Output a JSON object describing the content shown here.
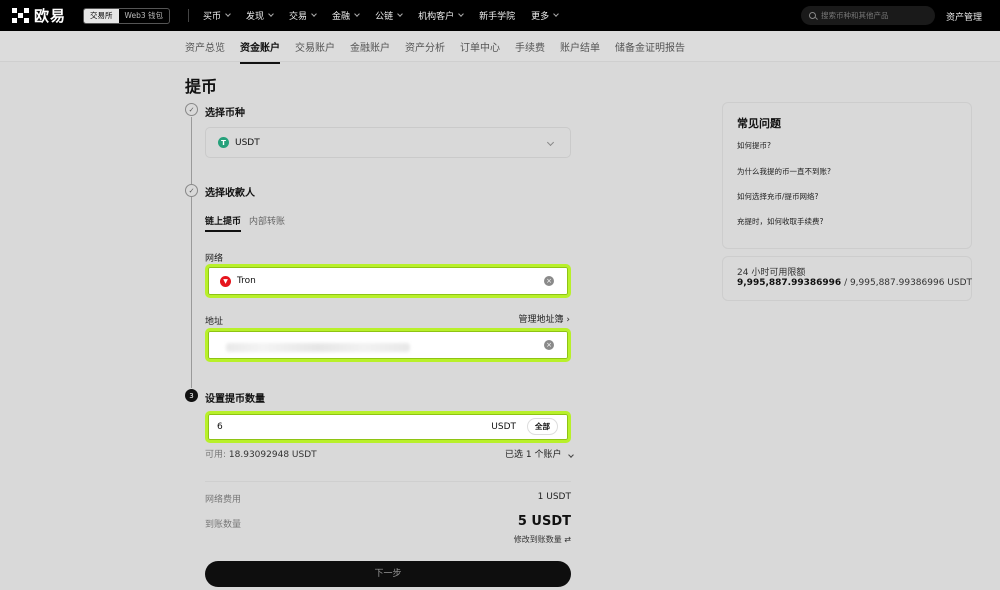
{
  "topnav": {
    "logo_text": "欧易",
    "mode_exchange": "交易所",
    "mode_web3": "Web3 钱包",
    "items": [
      "买币",
      "发现",
      "交易",
      "金融",
      "公链",
      "机构客户",
      "新手学院",
      "更多"
    ],
    "search_placeholder": "搜索币种和其他产品",
    "asset_management": "资产管理"
  },
  "subnav": {
    "items": [
      "资产总览",
      "资金账户",
      "交易账户",
      "金融账户",
      "资产分析",
      "订单中心",
      "手续费",
      "账户结单",
      "储备金证明报告"
    ],
    "active_index": 1
  },
  "page": {
    "title": "提币",
    "step1_title": "选择币种",
    "coin": "USDT",
    "step2_title": "选择收款人",
    "tabs": [
      "链上提币",
      "内部转账"
    ],
    "network_label": "网络",
    "network_value": "Tron",
    "address_label": "地址",
    "address_book": "管理地址簿",
    "step3_number": "3",
    "step3_title": "设置提币数量",
    "amount_value": "6",
    "amount_unit": "USDT",
    "all_button": "全部",
    "available_label": "可用:",
    "available_value": "18.93092948 USDT",
    "selected_accounts": "已选 1 个账户",
    "fee_label": "网络费用",
    "fee_value": "1 USDT",
    "receive_label": "到账数量",
    "receive_value": "5 USDT",
    "modify_receive": "修改到账数量",
    "next_button": "下一步"
  },
  "faq": {
    "title": "常见问题",
    "links": [
      "如何提币?",
      "为什么我提的币一直不到账?",
      "如何选择充币/提币网络?",
      "充提时，如何收取手续费?"
    ]
  },
  "limit": {
    "label": "24 小时可用限额",
    "available": "9,995,887.99386996",
    "total": " / 9,995,887.99386996 USDT"
  },
  "colors": {
    "highlight_border": "#b8f02a",
    "usdt_icon": "#26a17b",
    "tron_icon": "#e6151d"
  }
}
